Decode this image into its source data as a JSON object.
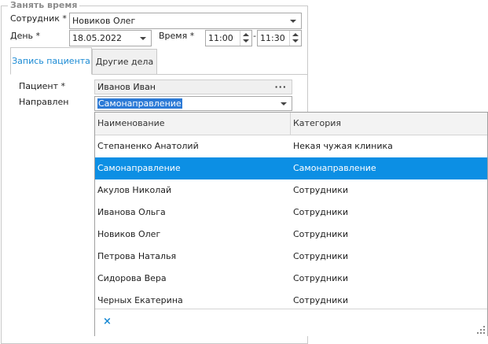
{
  "group": {
    "title": "Занять время"
  },
  "employee": {
    "label": "Сотрудник *",
    "value": "Новиков Олег"
  },
  "day": {
    "label": "День *",
    "value": "18.05.2022"
  },
  "time": {
    "label": "Время *",
    "from": "11:00",
    "dash": "-",
    "to": "11:30"
  },
  "tabs": [
    {
      "label": "Запись пациента",
      "active": true
    },
    {
      "label": "Другие дела",
      "active": false
    }
  ],
  "patient": {
    "label": "Пациент *",
    "value": "Иванов Иван",
    "more": "···"
  },
  "referred": {
    "label": "Направлен",
    "value": "Самонаправление"
  },
  "dropdown": {
    "columns": [
      "Наименование",
      "Категория"
    ],
    "rows": [
      {
        "name": "Степаненко Анатолий",
        "category": "Некая чужая клиника",
        "selected": false
      },
      {
        "name": "Самонаправление",
        "category": "Самонаправление",
        "selected": true
      },
      {
        "name": "Акулов Николай",
        "category": "Сотрудники",
        "selected": false
      },
      {
        "name": "Иванова Ольга",
        "category": "Сотрудники",
        "selected": false
      },
      {
        "name": "Новиков Олег",
        "category": "Сотрудники",
        "selected": false
      },
      {
        "name": "Петрова Наталья",
        "category": "Сотрудники",
        "selected": false
      },
      {
        "name": "Сидорова Вера",
        "category": "Сотрудники",
        "selected": false
      },
      {
        "name": "Черных Екатерина",
        "category": "Сотрудники",
        "selected": false
      }
    ],
    "clear_icon": "×"
  },
  "colors": {
    "accent": "#1a8ad4",
    "selection": "#0c8fe4"
  }
}
